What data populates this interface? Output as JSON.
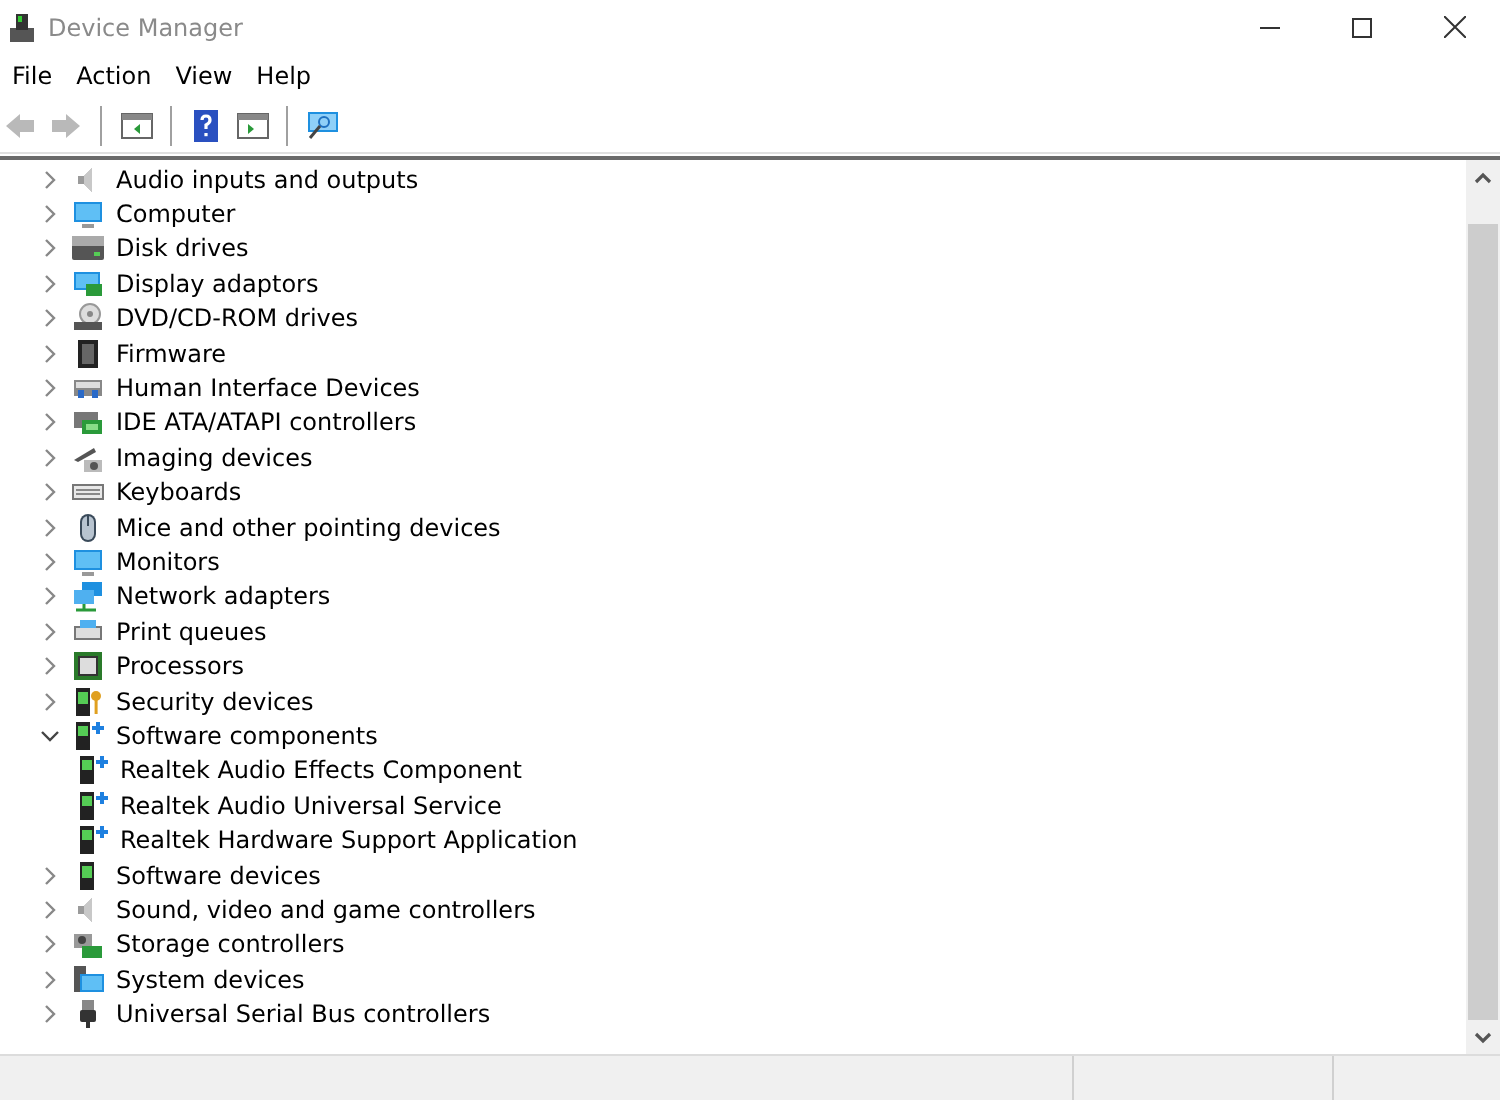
{
  "window": {
    "title": "Device Manager"
  },
  "menu": [
    "File",
    "Action",
    "View",
    "Help"
  ],
  "toolbar": [
    {
      "kind": "back",
      "disabled": true
    },
    {
      "kind": "forward",
      "disabled": true
    },
    {
      "kind": "sep"
    },
    {
      "kind": "properties",
      "disabled": false
    },
    {
      "kind": "sep"
    },
    {
      "kind": "help",
      "disabled": false
    },
    {
      "kind": "showhide",
      "disabled": false
    },
    {
      "kind": "sep"
    },
    {
      "kind": "scan",
      "disabled": false
    }
  ],
  "tree": [
    {
      "label": "Audio inputs and outputs",
      "expanded": false
    },
    {
      "label": "Computer",
      "expanded": false
    },
    {
      "label": "Disk drives",
      "expanded": false
    },
    {
      "label": "Display adaptors",
      "expanded": false
    },
    {
      "label": "DVD/CD-ROM drives",
      "expanded": false
    },
    {
      "label": "Firmware",
      "expanded": false
    },
    {
      "label": "Human Interface Devices",
      "expanded": false
    },
    {
      "label": "IDE ATA/ATAPI controllers",
      "expanded": false
    },
    {
      "label": "Imaging devices",
      "expanded": false
    },
    {
      "label": "Keyboards",
      "expanded": false
    },
    {
      "label": "Mice and other pointing devices",
      "expanded": false
    },
    {
      "label": "Monitors",
      "expanded": false
    },
    {
      "label": "Network adapters",
      "expanded": false
    },
    {
      "label": "Print queues",
      "expanded": false
    },
    {
      "label": "Processors",
      "expanded": false
    },
    {
      "label": "Security devices",
      "expanded": false
    },
    {
      "label": "Software components",
      "expanded": true,
      "children": [
        {
          "label": "Realtek Audio Effects Component"
        },
        {
          "label": "Realtek Audio Universal Service"
        },
        {
          "label": "Realtek Hardware Support Application"
        }
      ]
    },
    {
      "label": "Software devices",
      "expanded": false
    },
    {
      "label": "Sound, video and game controllers",
      "expanded": false
    },
    {
      "label": "Storage controllers",
      "expanded": false
    },
    {
      "label": "System devices",
      "expanded": false
    },
    {
      "label": "Universal Serial Bus controllers",
      "expanded": false
    }
  ]
}
